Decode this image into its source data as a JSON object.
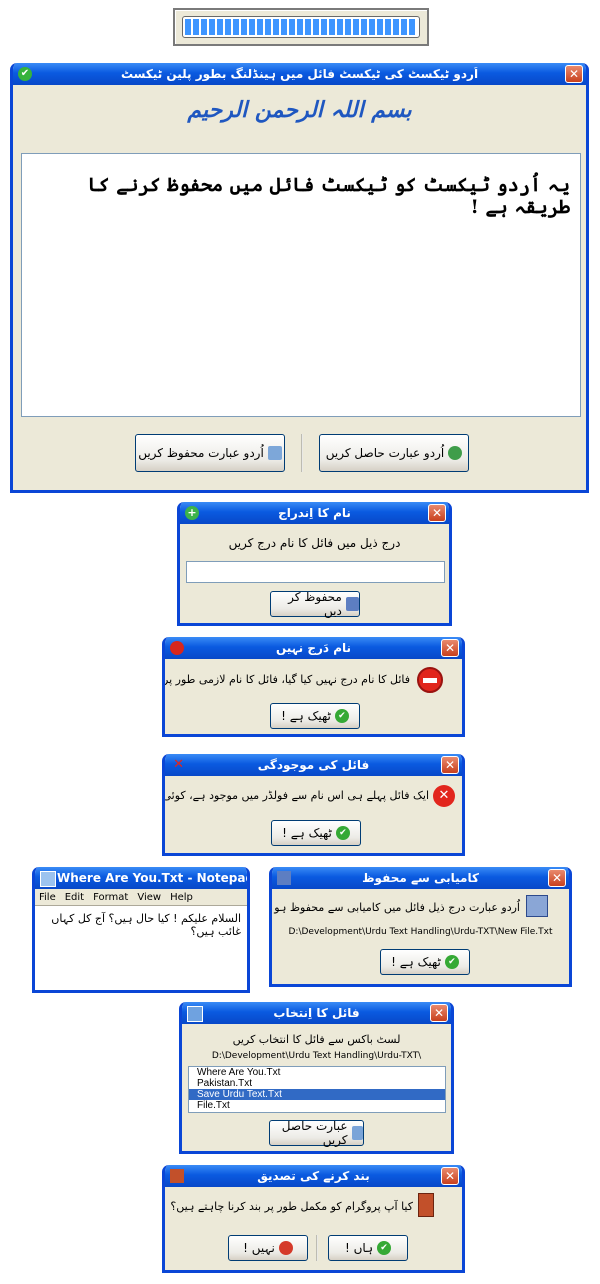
{
  "splash": {
    "progress_percent": 100
  },
  "main": {
    "title": "اُردو ٹیکسٹ کی ٹیکسٹ فائل میں ہینڈلنگ بطور پلین ٹیکسٹ",
    "bismillah": "بسم اللہ الرحمن الرحیم",
    "body_text": "یہ اُردو ٹیکسٹ کو ٹیکسٹ فائل میں محفوظ کرنے کا طریقہ ہے !",
    "save_button": "اُردو عبارت محفوظ کریں",
    "load_button": "اُردو عبارت حاصل کریں"
  },
  "name_entry": {
    "title": "نام کا اِندراج",
    "prompt": "درج ذیل میں فائل کا نام درج کریں",
    "input_value": "",
    "save_button": "محفوظ کر دیں"
  },
  "name_missing": {
    "title": "نام دَرج نہیں",
    "message": "فائل کا نام درج نہیں کیا گیا، فائل کا نام لازمی طور پر درج کریں !",
    "ok_button": "ٹھیک ہے !"
  },
  "file_exists": {
    "title": "فائل کی موجودگی",
    "message": "ایک فائل پہلے ہی اس نام سے فولڈر میں موجود ہے، کوئی اور نام منتخب کریں !",
    "ok_button": "ٹھیک ہے !"
  },
  "notepad": {
    "title": "Where Are You.Txt - Notepad",
    "menu": [
      "File",
      "Edit",
      "Format",
      "View",
      "Help"
    ],
    "content": "السلام علیکم ! کیا حال ہیں؟ آج کل کہاں غائب ہیں؟"
  },
  "save_success": {
    "title": "کامیابی سے محفوظ",
    "message": "اُردو عبارت درج ذیل فائل میں کامیابی سے محفوظ ہو گئی ہے !",
    "path": "D:\\Development\\Urdu Text Handling\\Urdu-TXT\\New File.Txt",
    "ok_button": "ٹھیک ہے !"
  },
  "file_select": {
    "title": "فائل کا اِنتخاب",
    "prompt": "لسٹ باکس سے فائل کا انتخاب کریں",
    "path": "D:\\Development\\Urdu Text Handling\\Urdu-TXT\\",
    "files": [
      "Where Are You.Txt",
      "Pakistan.Txt",
      "Save Urdu Text.Txt",
      "File.Txt"
    ],
    "selected_index": 2,
    "get_button": "عبارت حاصل کریں"
  },
  "close_confirm": {
    "title": "بند کرنے کی تصدیق",
    "message": "کیا آپ پروگرام کو مکمل طور پر بند کرنا چاہتے ہیں؟",
    "no_button": "نہیں !",
    "yes_button": "ہاں !"
  },
  "colors": {
    "titlebar": "#0a5ae0",
    "window_bg": "#ece9d8",
    "close": "#c8401e",
    "selection": "#316ac5",
    "bismillah": "#1f57c0"
  }
}
